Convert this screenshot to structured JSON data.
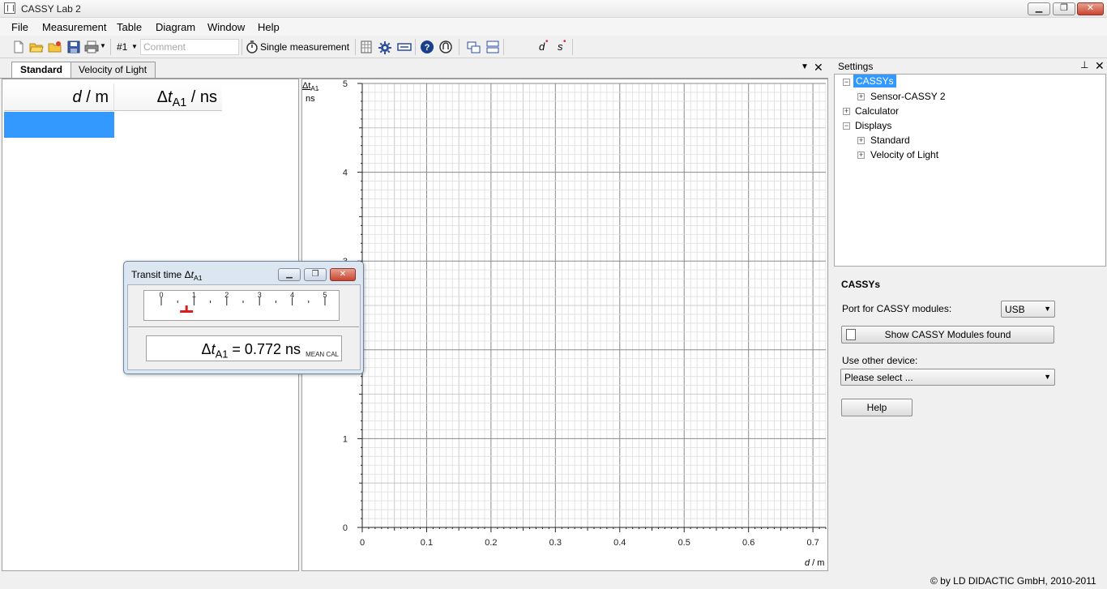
{
  "window": {
    "title": "CASSY Lab 2"
  },
  "menu": [
    "File",
    "Measurement",
    "Table",
    "Diagram",
    "Window",
    "Help"
  ],
  "toolbar": {
    "measurement_number": "#1",
    "comment_placeholder": "Comment",
    "single_measurement": "Single measurement",
    "symbol_dt": "Δt",
    "symbol_dt_sub": "A1",
    "symbol_d": "d",
    "symbol_s": "s"
  },
  "tabs": [
    "Standard",
    "Velocity of Light"
  ],
  "table": {
    "col1": {
      "symbol": "d",
      "unit": " / m"
    },
    "col2": {
      "symbol_prefix": "Δ",
      "symbol": "t",
      "sub": "A1",
      "unit": " / ns"
    }
  },
  "chart_data": {
    "type": "scatter",
    "x": [],
    "y": [],
    "xlabel_symbol": "d",
    "xlabel_unit": " / m",
    "ylabel_symbol": "Δt",
    "ylabel_sub": "A1",
    "ylabel_unit": "ns",
    "xlim": [
      0,
      0.72
    ],
    "ylim": [
      0,
      5
    ],
    "xticks": [
      "0",
      "0.1",
      "0.2",
      "0.3",
      "0.4",
      "0.5",
      "0.6",
      "0.7"
    ],
    "yticks": [
      "0",
      "1",
      "2",
      "3",
      "4",
      "5"
    ],
    "grid": true
  },
  "meter_window": {
    "title_prefix": "Transit time Δ",
    "title_sym": "t",
    "title_sub": "A1",
    "scale_labels": [
      "0",
      "1",
      "2",
      "3",
      "4",
      "5"
    ],
    "value": 0.772,
    "readout_prefix": "Δ",
    "readout_sym": "t",
    "readout_sub": "A1",
    "readout_value": " = 0.772 ns",
    "readout_tag": "MEAN CAL"
  },
  "settings": {
    "title": "Settings",
    "tree": {
      "cassys": "CASSYs",
      "sensor": "Sensor-CASSY 2",
      "calculator": "Calculator",
      "displays": "Displays",
      "standard": "Standard",
      "velocity": "Velocity of Light"
    },
    "section_title": "CASSYs",
    "port_label": "Port for CASSY modules:",
    "port_value": "USB",
    "show_modules": "Show CASSY Modules found",
    "other_device_label": "Use other device:",
    "device_value": "Please select ...",
    "help": "Help"
  },
  "footer": {
    "copyright": "©  by LD DIDACTIC GmbH, 2010-2011"
  }
}
